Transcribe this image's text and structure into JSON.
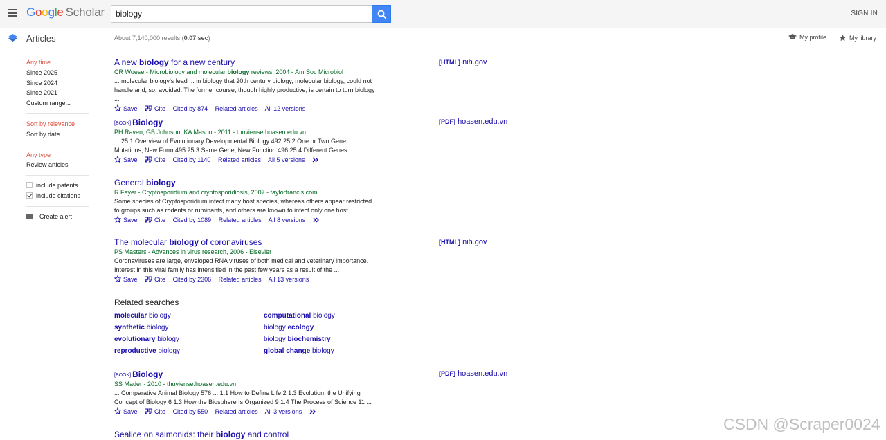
{
  "header": {
    "logo_letters": [
      "G",
      "o",
      "o",
      "g",
      "l",
      "e"
    ],
    "logo_suffix": "Scholar",
    "search_value": "biology",
    "signin_label": "SIGN IN"
  },
  "subheader": {
    "section_label": "Articles",
    "results_prefix": "About 7,140,000 results (",
    "results_time": "0.07 sec",
    "results_suffix": ")",
    "my_profile": "My profile",
    "my_library": "My library"
  },
  "sidebar": {
    "time_filters": [
      "Any time",
      "Since 2025",
      "Since 2024",
      "Since 2021",
      "Custom range..."
    ],
    "sort_options": [
      "Sort by relevance",
      "Sort by date"
    ],
    "type_filters": [
      "Any type",
      "Review articles"
    ],
    "include_patents": "include patents",
    "include_citations": "include citations",
    "create_alert": "Create alert"
  },
  "results": [
    {
      "title_pre": "A new ",
      "title_bold": "biology",
      "title_post": " for a new century",
      "authors_pre": "CR Woese - Microbiology and molecular ",
      "authors_bold": "biology",
      "authors_post": " reviews, 2004 - Am Soc Microbiol",
      "snippet_1": "... molecular biology's lead ... in biology that 20th century biology, molecular biology, could not",
      "snippet_2": "handle and, so, avoided. The former course, though highly productive, is certain to turn biology ...",
      "save": "Save",
      "cite": "Cite",
      "cited_by": "Cited by 874",
      "related": "Related articles",
      "versions": "All 12 versions",
      "side_type": "[HTML]",
      "side_domain": "nih.gov"
    },
    {
      "tag": "[BOOK]",
      "title_bold": "Biology",
      "authors_full": "PH Raven, GB Johnson, KA Mason - 2011 - thuviense.hoasen.edu.vn",
      "snippet_1": "... 25.1 Overview of Evolutionary Developmental Biology 492 25.2 One or Two Gene",
      "snippet_2": "Mutations, New Form 495 25.3 Same Gene, New Function 496 25.4 Different Genes ...",
      "save": "Save",
      "cite": "Cite",
      "cited_by": "Cited by 1140",
      "related": "Related articles",
      "versions": "All 5 versions",
      "side_type": "[PDF]",
      "side_domain": "hoasen.edu.vn"
    },
    {
      "title_pre": "General ",
      "title_bold": "biology",
      "authors_full": "R Fayer - Cryptosporidium and cryptosporidiosis, 2007 - taylorfrancis.com",
      "snippet_1": "Some species of Cryptosporidium infect many host species, whereas others appear restricted",
      "snippet_2": "to groups such as rodents or ruminants, and others are known to infect only one host ...",
      "save": "Save",
      "cite": "Cite",
      "cited_by": "Cited by 1089",
      "related": "Related articles",
      "versions": "All 8 versions"
    },
    {
      "title_pre": "The molecular ",
      "title_bold": "biology",
      "title_post": " of coronaviruses",
      "authors_full": "PS Masters - Advances in virus research, 2006 - Elsevier",
      "snippet_1": "Coronaviruses are large, enveloped RNA viruses of both medical and veterinary importance.",
      "snippet_2": "Interest in this viral family has intensified in the past few years as a result of the ...",
      "save": "Save",
      "cite": "Cite",
      "cited_by": "Cited by 2306",
      "related": "Related articles",
      "versions": "All 13 versions",
      "side_type": "[HTML]",
      "side_domain": "nih.gov"
    },
    {
      "tag": "[BOOK]",
      "title_bold": "Biology",
      "authors_full": "SS Mader - 2010 - thuviense.hoasen.edu.vn",
      "snippet_1": "... Comparative Animal Biology 576 ... 1.1 How to Define Life 2 1.3 Evolution, the Unifying",
      "snippet_2": "Concept of Biology 6 1.3 How the Biosphere Is Organized 9 1.4 The Process of Science 11 ...",
      "save": "Save",
      "cite": "Cite",
      "cited_by": "Cited by 550",
      "related": "Related articles",
      "versions": "All 3 versions",
      "side_type": "[PDF]",
      "side_domain": "hoasen.edu.vn"
    },
    {
      "title_pre": "Sealice on salmonids: their ",
      "title_bold": "biology",
      "title_post": " and control"
    }
  ],
  "related_searches": {
    "title": "Related searches",
    "items": [
      {
        "bold": "molecular",
        "rest": " biology"
      },
      {
        "bold": "computational",
        "rest": " biology"
      },
      {
        "bold": "synthetic",
        "rest": " biology"
      },
      {
        "pre": "biology ",
        "bold": "ecology"
      },
      {
        "bold": "evolutionary",
        "rest": " biology"
      },
      {
        "pre": "biology ",
        "bold": "biochemistry"
      },
      {
        "bold": "reproductive",
        "rest": " biology"
      },
      {
        "bold": "global change",
        "rest": " biology"
      }
    ]
  },
  "watermark": "CSDN @Scraper0024",
  "colors": {
    "link": "#1a0dab",
    "authors": "#006621",
    "active_filter": "#dd4b39",
    "search_button": "#4285f4"
  }
}
